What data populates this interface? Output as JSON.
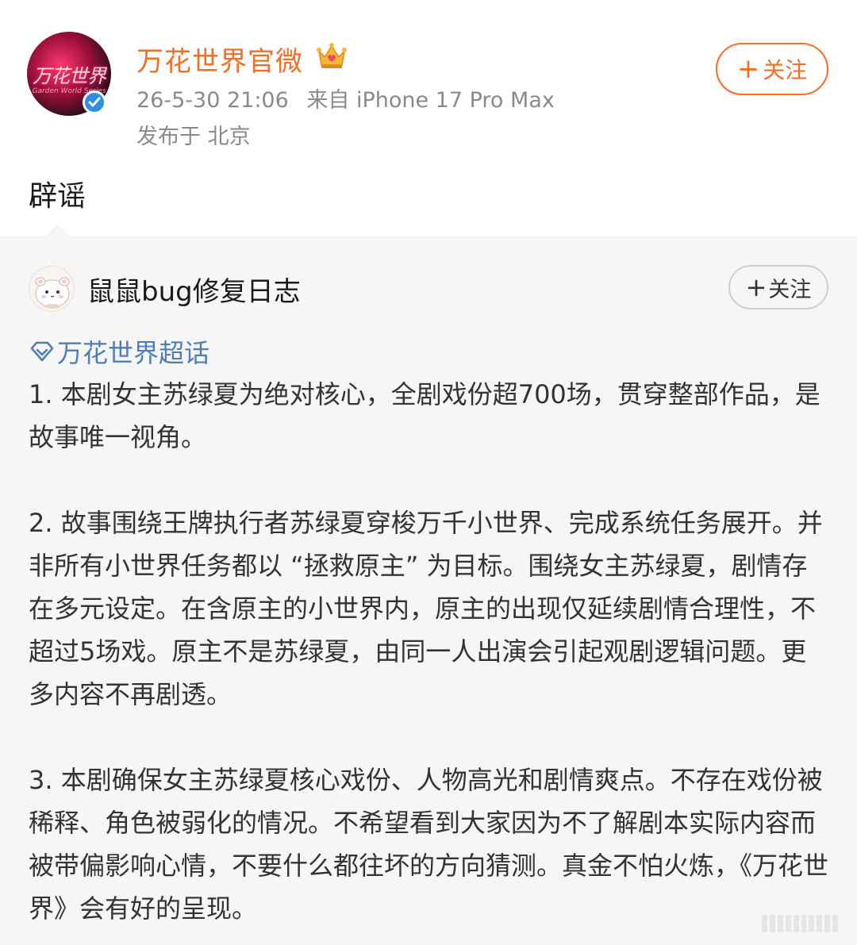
{
  "author": {
    "name": "万花世界官微",
    "avatar_text": "万花世界",
    "avatar_subtext": "Garden World Series",
    "timestamp": "26-5-30 21:06",
    "source": "来自 iPhone 17 Pro Max",
    "location": "发布于 北京",
    "follow_plus": "+",
    "follow_label": "关注"
  },
  "post": {
    "text": "辟谣"
  },
  "repost": {
    "author_name": "鼠鼠bug修复日志",
    "follow_plus": "+",
    "follow_label": "关注",
    "supertopic": "万花世界超话",
    "paragraphs": [
      "1. 本剧女主苏绿夏为绝对核心，全剧戏份超700场，贯穿整部作品，是故事唯一视角。",
      "2. 故事围绕王牌执行者苏绿夏穿梭万千小世界、完成系统任务展开。并非所有小世界任务都以 “拯救原主” 为目标。围绕女主苏绿夏，剧情存在多元设定。在含原主的小世界内，原主的出现仅延续剧情合理性，不超过5场戏。原主不是苏绿夏，由同一人出演会引起观剧逻辑问题。更多内容不再剧透。",
      "3. 本剧确保女主苏绿夏核心戏份、人物高光和剧情爽点。不存在戏份被稀释、角色被弱化的情况。不希望看到大家因为不了解剧本实际内容而被带偏影响心情，不要什么都往坏的方向猜测。真金不怕火炼，《万花世界》会有好的呈现。"
    ]
  },
  "colors": {
    "author_name": "#f76d22",
    "supertopic": "#4f7db8",
    "verified": "#2f8fe6"
  },
  "icons": {
    "verified": "verified-icon",
    "crown": "crown-icon",
    "supertopic": "diamond-icon"
  }
}
